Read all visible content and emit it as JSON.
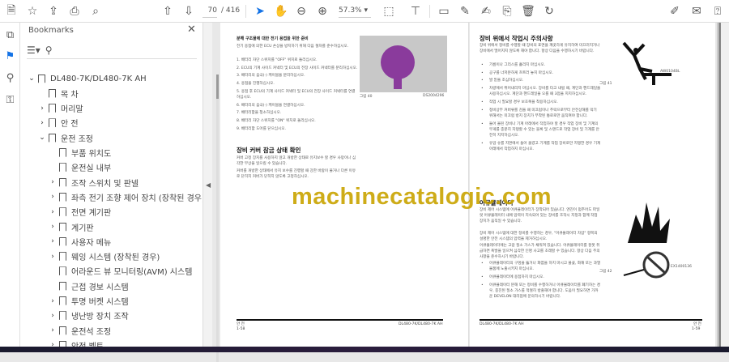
{
  "toolbar": {
    "page_current": "70",
    "page_total": "/ 416",
    "zoom": "57.3%"
  },
  "bookmarks": {
    "title": "Bookmarks",
    "items": [
      {
        "label": "DL480-7K/DL480-7K AH",
        "level": 0,
        "chevron": "down"
      },
      {
        "label": "목 차",
        "level": 1,
        "chevron": ""
      },
      {
        "label": "머리말",
        "level": 1,
        "chevron": "right"
      },
      {
        "label": "안 전",
        "level": 1,
        "chevron": "right"
      },
      {
        "label": "운전 조정",
        "level": 1,
        "chevron": "down"
      },
      {
        "label": "부품 위치도",
        "level": 2,
        "chevron": ""
      },
      {
        "label": "운전실 내부",
        "level": 2,
        "chevron": ""
      },
      {
        "label": "조작 스위치 및 판넬",
        "level": 2,
        "chevron": "right"
      },
      {
        "label": "좌측 전기 조향 제어 장치 (장착된 경우)",
        "level": 2,
        "chevron": "right"
      },
      {
        "label": "전면 계기판",
        "level": 2,
        "chevron": "right"
      },
      {
        "label": "계기판",
        "level": 2,
        "chevron": "right"
      },
      {
        "label": "사용자 메뉴",
        "level": 2,
        "chevron": "right"
      },
      {
        "label": "웨잉 시스템 (장착된 경우)",
        "level": 2,
        "chevron": "right"
      },
      {
        "label": "어라운드 뷰 모니터링(AVM) 시스템",
        "level": 2,
        "chevron": ""
      },
      {
        "label": "근접 경보 시스템",
        "level": 2,
        "chevron": ""
      },
      {
        "label": "투명 버켓 시스템",
        "level": 2,
        "chevron": "right"
      },
      {
        "label": "냉난방 장치 조작",
        "level": 2,
        "chevron": "right"
      },
      {
        "label": "운전석 조정",
        "level": 2,
        "chevron": "right"
      },
      {
        "label": "안전 벨트",
        "level": 2,
        "chevron": "right"
      }
    ]
  },
  "left_page": {
    "section1_title": "분해 구조물에 대한 전기 용접을 위한 준비",
    "section1_intro": "전기 용접에 의한 ECU 손상을 방지하기 위해 다음 절차를 준수하십시오.",
    "steps": [
      "1.  배터리 차단 스위치를 \"OFF\" 위치로 돌리십시오.",
      "2.  ECU의 기계 사이드 커넥터 및 ECU의 전장 사이드 커넥터를 분리하십시오.",
      "3.  배터리의 음극(-) 케이블을 분리하십시오.",
      "4.  용접을 진행하십시오.",
      "5.  용접 후 ECU의 기계 사이드 커넥터 및 ECU의 전장 사이드 커넥터를 연결하십시오.",
      "6.  배터리의 음극(-) 케이블을 연결하십시오.",
      "7.  배터리함을 청소하십시오.",
      "8.  배터리 차단 스위치를 \"ON\" 위치로 돌리십시오.",
      "9.  배터리함 도어를 닫으십시오."
    ],
    "figure_label": "그림 40",
    "figure_code": "DS2004296",
    "section2_title": "장비 커버 잠금 상태 확인",
    "section2_p1": "커버 고정 장치를 사용하지 않고 개방한 상태로 유지보수 할 경우 사망이나 심각한 부상을 일으킬 수 있습니다.",
    "section2_p2": "커버를 개방한 상태에서 유지 보수를 진행할 때 강한 바람이 불거나 다른 이유로 닫히지 커버가 닫히지 않도록 고정하십시오.",
    "footer_left": "안 전",
    "footer_page": "1-58",
    "footer_right": "DL480-7K/DL480-7K AH"
  },
  "right_page": {
    "section1_title": "장비 위에서 작업시 주의사항",
    "section1_intro": "장비 위에서 정비를 수행할 때 장비의 표면을 깨끗하게 유지하여 미끄러지거나 장비에서 떨어지지 않도록 해야 합니다. 항상 다음을 수행하시기 바랍니다.",
    "bullets1": [
      "기름이나 그리스를 흘리지 마십시오.",
      "공구를 너저분하게 흐트러 놓지 마십시오.",
      "발 밑을 조심하십시오.",
      "차량에서 뛰어내리지 마십시오. 장비를 타고 내릴 때, 계단과 핸드레일을 사용하십시오. 계단과 핸드레일을 오를 때 3점을 지지하십시오.",
      "작업 시 필요할 경우 보호복을 착용하십시오.",
      "정비상부 커버류를 검을 때 미끄럼이나 추락으로부터 안전상해를 막기 위해서는 미끄럼 방지 장치가 부착된 통로로만 움직여야 합니다.",
      "들어 올린 장비나 기계 아래에서 작업하야 할 경우 작업 장비 및 기계의 무게를 충분히 지탱할 수 있는 블록 및 스탠드로 작업 장비 및 기계를 안전히 지지하십시오.",
      "유압 슈를 지면에서 들어 올렸고 기계를 작업 장비로만 지탱한 경우 기계 아래에서 작업하지 마십시오."
    ],
    "figure1_label": "그림 41",
    "figure1_code": "AW0104BL",
    "section2_title": "어큐뮬레이터",
    "section2_p1": "장비 제어 시스템에 어큐뮬레이터가 장착되어 있습니다. 엔진이 멈추어도 파일럿 어큐뮬레이터 내에 압력이 지속되어 있는 장비를 조작시 지정과 함께 작업 장치가 움직일 수 있습니다.",
    "section2_p2": "장비 제어 시스템에 대한 정비를 수행하는 경우, \"어큐뮬레이터 차압\" 항목의 설명한 안전 시스템의 압력을 제거하십시오.",
    "section2_p3": "어큐뮬레이터에는 고압 질소 가스가 채워져 있습니다. 어큐뮬레이터를 잘못 취급하면 폭발을 일으켜 심각한 인명 사고를 초래할 수 있습니다. 항상 다음 주의사항을 준수하시기 바랍니다.",
    "bullets2": [
      "어큐뮬레이터의 구멍을 뚫거나 화염을 하지 마시고 불꽃, 화재 또는 과열 물품에 노출시키지 마십시오.",
      "어큐뮬레이터에 용접하지 마십시오.",
      "어큐뮬레이터 분해 또는 정비를 수행하거나 어큐뮬레이터를 폐기하는 경우, 충진된 질소 가스를 적절히 방출해야 합니다. 도움이 필요하면 가까운 DEVELON 대리점에 문의하시기 바랍니다."
    ],
    "figure2_label": "그림 42",
    "figure2_code": "EX1400136",
    "footer_left": "DL480-7K/DL480-7K AH",
    "footer_right": "안 전",
    "footer_page": "1-59"
  },
  "watermark": "machinecatalogic.com"
}
